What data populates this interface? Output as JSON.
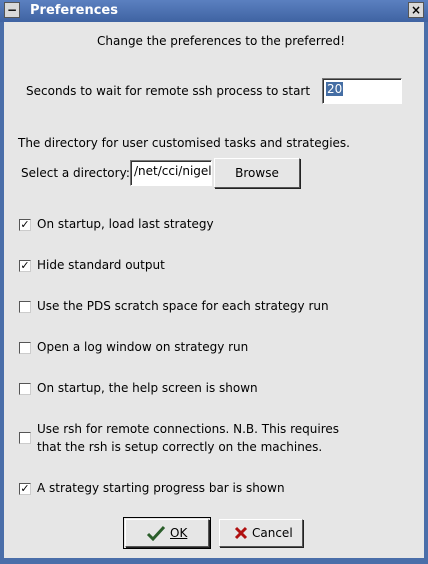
{
  "window": {
    "title": "Preferences"
  },
  "header": "Change the preferences to the preferred!",
  "ssh": {
    "label": "Seconds to wait for remote ssh process to start",
    "value": "20"
  },
  "directory": {
    "description": "The directory for user customised tasks and strategies.",
    "select_label": "Select a directory:",
    "value": "/net/cci/nigel",
    "browse_label": "Browse"
  },
  "options": [
    {
      "label": "On startup, load last strategy",
      "checked": true
    },
    {
      "label": "Hide standard output",
      "checked": true
    },
    {
      "label": "Use the PDS scratch space for each strategy run",
      "checked": false
    },
    {
      "label": "Open a log window on strategy run",
      "checked": false
    },
    {
      "label": "On startup, the help screen is shown",
      "checked": false
    },
    {
      "label_line1": "Use rsh for remote connections.  N.B. This requires",
      "label_line2": "that the rsh is setup correctly on the machines.",
      "checked": false
    },
    {
      "label": "A strategy starting progress bar is shown",
      "checked": true
    }
  ],
  "buttons": {
    "ok": "OK",
    "cancel": "Cancel"
  },
  "colors": {
    "titlebar": "#4a6ea9",
    "dialog_bg": "#e6e6e6",
    "selection": "#456ea4"
  }
}
